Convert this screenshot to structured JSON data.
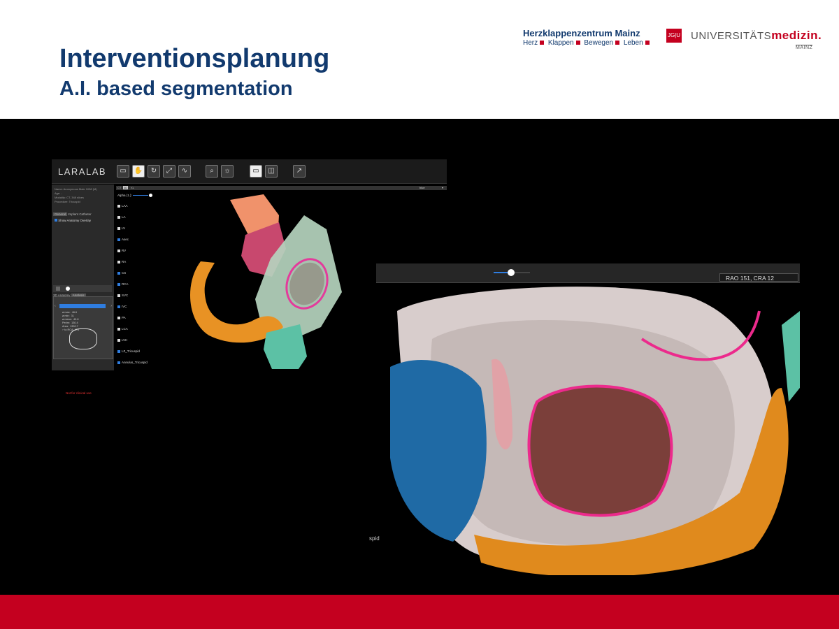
{
  "slide": {
    "title": "Interventionsplanung",
    "subtitle": "A.I. based segmentation"
  },
  "logos": {
    "herzklappenzentrum": {
      "name": "Herzklappenzentrum Mainz",
      "tagline": [
        "Herz",
        "Klappen",
        "Bewegen",
        "Leben"
      ]
    },
    "jgu": "JG|U",
    "universitaetsmedizin": {
      "prefix": "UNIVERSITÄTS",
      "suffix": "medizin.",
      "city": "MAINZ"
    }
  },
  "colors": {
    "brand_blue": "#123a6e",
    "brand_red": "#c4001f",
    "accent_blue": "#2f7de0"
  },
  "app1": {
    "brand": "LARALAB",
    "toolbar_icons": [
      "folder-icon",
      "hand-icon",
      "rotate-icon",
      "measure-icon",
      "curve-icon",
      "zoom-icon",
      "brightness-icon",
      "single-view-icon",
      "split-view-icon",
      "export-icon"
    ],
    "patient_info": [
      "Name:    Anonymous Male 1038 (M)",
      "Age:       -",
      "Modality:      CT, 348 slices",
      "Procedure:     Tricuspid"
    ],
    "subtabs": [
      "General",
      "Implant",
      "Catheter"
    ],
    "overlay_option": "Show Anatomy Overlay",
    "analysis_tabs": [
      "3D Anatomy",
      "Analysis"
    ],
    "analysis_values": "ø max:  46.6\nø min:  31\nø mean:  40.8\nPerim:  130.4\nArea:  1332.7\n⌐ to RCA:  2.4",
    "clinical_warning": "Not for clinical use",
    "view_tabs": [
      "CT",
      "3D",
      "XL"
    ],
    "color_select": "blue",
    "alpha_label": "Alpha (1.):",
    "layers": [
      {
        "name": "LAA",
        "checked": false
      },
      {
        "name": "LA",
        "checked": false
      },
      {
        "name": "LV",
        "checked": false
      },
      {
        "name": "Asec",
        "checked": true
      },
      {
        "name": "RV",
        "checked": false
      },
      {
        "name": "RA",
        "checked": false
      },
      {
        "name": "CS",
        "checked": true
      },
      {
        "name": "RCA",
        "checked": true
      },
      {
        "name": "SVC",
        "checked": false
      },
      {
        "name": "IVC",
        "checked": true
      },
      {
        "name": "PA",
        "checked": false
      },
      {
        "name": "LCA",
        "checked": false
      },
      {
        "name": "LVH",
        "checked": false
      },
      {
        "name": "LZ_Tricuspid",
        "checked": true
      },
      {
        "name": "Annulus_Tricuspid",
        "checked": true
      }
    ]
  },
  "app2": {
    "view_readout": "RAO 151, CRA 12",
    "slider_level": 0.5,
    "partial_label": "spid"
  }
}
